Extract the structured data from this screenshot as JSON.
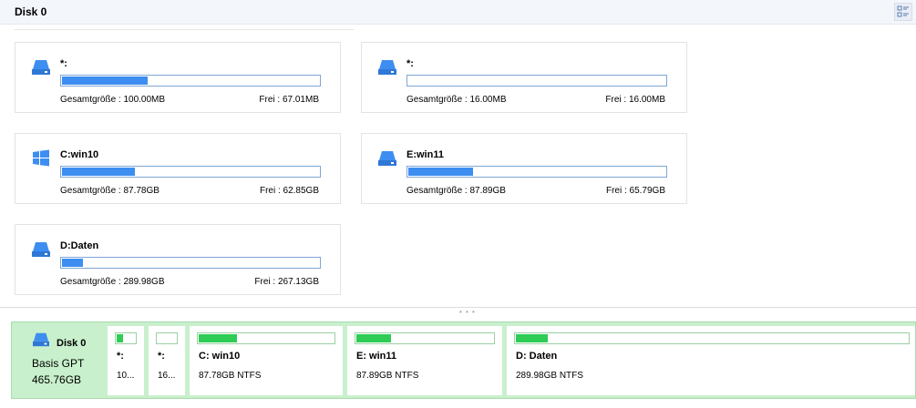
{
  "header": {
    "title": "Disk 0",
    "view_toggle_icon": "list-view-icon"
  },
  "partitions": [
    {
      "name": "*:",
      "total": "Gesamtgröße : 100.00MB",
      "free": "Frei : 67.01MB",
      "used_fraction": 0.33,
      "icon": "drive-icon"
    },
    {
      "name": "*:",
      "total": "Gesamtgröße : 16.00MB",
      "free": "Frei : 16.00MB",
      "used_fraction": 0.0,
      "icon": "drive-icon"
    },
    {
      "name": "C:win10",
      "total": "Gesamtgröße : 87.78GB",
      "free": "Frei : 62.85GB",
      "used_fraction": 0.28,
      "icon": "windows-icon"
    },
    {
      "name": "E:win11",
      "total": "Gesamtgröße : 87.89GB",
      "free": "Frei : 65.79GB",
      "used_fraction": 0.25,
      "icon": "drive-icon"
    },
    {
      "name": "D:Daten",
      "total": "Gesamtgröße : 289.98GB",
      "free": "Frei : 267.13GB",
      "used_fraction": 0.08,
      "icon": "drive-icon"
    }
  ],
  "disk_map": {
    "disk_name": "Disk 0",
    "disk_type": "Basis GPT",
    "disk_size": "465.76GB",
    "icon": "disk-icon",
    "blocks": [
      {
        "label": "*:",
        "info": "10...",
        "used_fraction": 0.33
      },
      {
        "label": "*:",
        "info": "16...",
        "used_fraction": 0.0
      },
      {
        "label": "C: win10",
        "info": "87.78GB NTFS",
        "used_fraction": 0.28
      },
      {
        "label": "E: win11",
        "info": "87.89GB NTFS",
        "used_fraction": 0.25
      },
      {
        "label": "D: Daten",
        "info": "289.98GB NTFS",
        "used_fraction": 0.08
      }
    ]
  },
  "colors": {
    "accent": "#3d8ef0",
    "disk_bar_bg": "#c8f0cc",
    "used_green": "#2ecc55",
    "icon_blue": "#3d8ef0"
  }
}
